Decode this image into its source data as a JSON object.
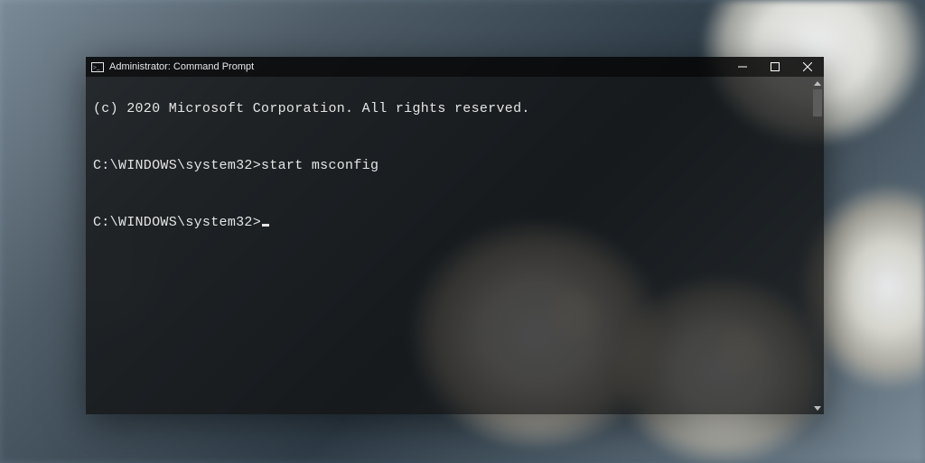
{
  "window": {
    "title": "Administrator: Command Prompt",
    "icon": "cmd-icon"
  },
  "terminal": {
    "lines": {
      "copyright": "(c) 2020 Microsoft Corporation. All rights reserved.",
      "blank1": "",
      "cmd1_prompt": "C:\\WINDOWS\\system32>",
      "cmd1_input": "start msconfig",
      "blank2": "",
      "cmd2_prompt": "C:\\WINDOWS\\system32>"
    }
  },
  "controls": {
    "minimize": "minimize",
    "maximize": "maximize",
    "close": "close"
  }
}
